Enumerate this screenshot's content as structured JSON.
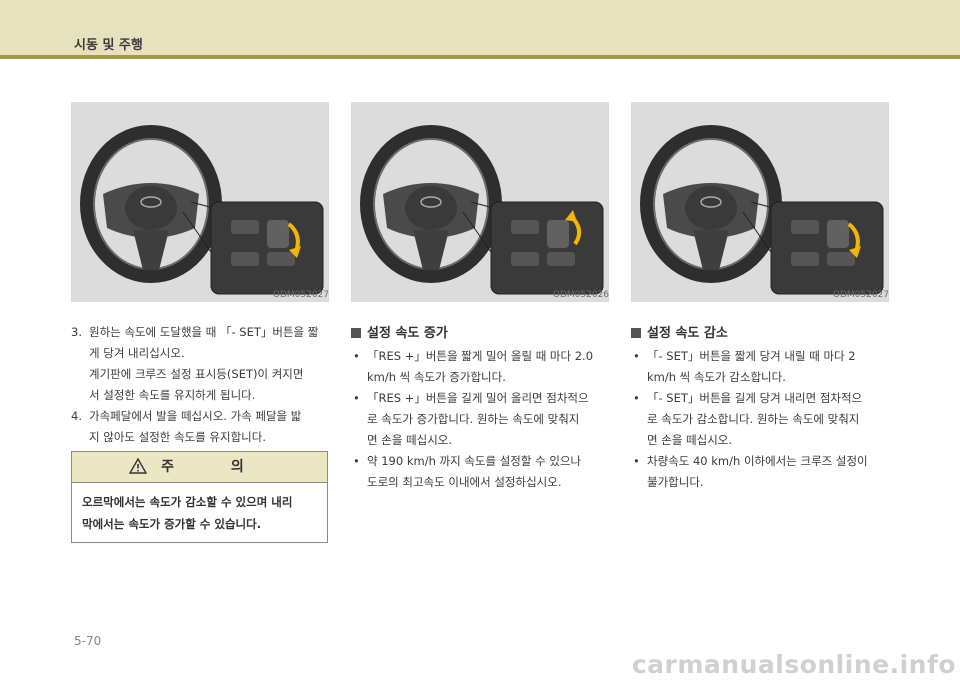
{
  "header": {
    "title": "시동 및 주행"
  },
  "figures": [
    {
      "caption": "ODM052027"
    },
    {
      "caption": "ODM052026"
    },
    {
      "caption": "ODM052027"
    }
  ],
  "left_column": {
    "items": [
      {
        "num": "3.",
        "lines": [
          "원하는 속도에 도달했을 때 「- SET」버튼을 짧",
          "게 당겨 내리십시오.",
          "계기판에 크루즈 설정 표시등(SET)이 켜지면",
          "서 설정한 속도를 유지하게 됩니다."
        ]
      },
      {
        "num": "4.",
        "lines": [
          "가속페달에서 발을 떼십시오. 가속 페달을 밟",
          "지 않아도 설정한 속도를 유지합니다."
        ]
      }
    ]
  },
  "caution": {
    "title": "주 의",
    "body_lines": [
      "오르막에서는 속도가 감소할 수 있으며 내리",
      "막에서는 속도가 증가할 수 있습니다."
    ]
  },
  "middle_column": {
    "heading": "설정 속도 증가",
    "bullets": [
      {
        "lines": [
          "「RES +」버튼을 짧게 밀어 올릴 때 마다 2.0",
          "km/h 씩 속도가 증가합니다."
        ]
      },
      {
        "lines": [
          "「RES +」버튼을 길게 밀어 올리면 점차적으",
          "로 속도가 증가합니다. 원하는 속도에 맞춰지",
          "면 손을 떼십시오."
        ]
      },
      {
        "lines": [
          "약 190 km/h 까지 속도를 설정할 수 있으나",
          "도로의 최고속도 이내에서 설정하십시오."
        ]
      }
    ]
  },
  "right_column": {
    "heading": "설정 속도 감소",
    "bullets": [
      {
        "lines": [
          "「- SET」버튼을 짧게 당겨 내릴 때 마다 2",
          "km/h 씩 속도가 감소합니다."
        ]
      },
      {
        "lines": [
          "「- SET」버튼을 길게 당겨 내리면 점차적으",
          "로 속도가 감소합니다. 원하는 속도에 맞춰지",
          "면 손을 떼십시오."
        ]
      },
      {
        "lines": [
          "차량속도 40 km/h 이하에서는 크루즈 설정이",
          "불가합니다."
        ]
      }
    ]
  },
  "page_number": "5-70",
  "watermark": "carmanualsonline.info",
  "colors": {
    "header_bg": "#e6e2bd",
    "header_rule": "#a29a45",
    "arrow": "#f2b800",
    "caution_head_bg": "#ebe7c4"
  }
}
